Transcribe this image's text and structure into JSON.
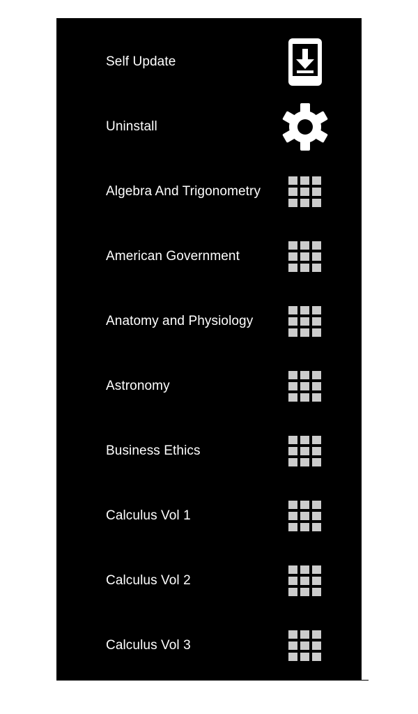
{
  "menu": {
    "items": [
      {
        "label": "Self Update",
        "icon": "download-device-icon"
      },
      {
        "label": "Uninstall",
        "icon": "gear-icon"
      },
      {
        "label": "Algebra And Trigonometry",
        "icon": "grid-icon"
      },
      {
        "label": "American Government",
        "icon": "grid-icon"
      },
      {
        "label": "Anatomy and Physiology",
        "icon": "grid-icon"
      },
      {
        "label": "Astronomy",
        "icon": "grid-icon"
      },
      {
        "label": "Business Ethics",
        "icon": "grid-icon"
      },
      {
        "label": "Calculus Vol 1",
        "icon": "grid-icon"
      },
      {
        "label": "Calculus Vol 2",
        "icon": "grid-icon"
      },
      {
        "label": "Calculus Vol 3",
        "icon": "grid-icon"
      }
    ]
  },
  "colors": {
    "panel_background": "#000000",
    "page_background": "#ffffff",
    "label_text": "#ffffff",
    "grid_icon": "#cccccc",
    "system_icon": "#ffffff"
  }
}
